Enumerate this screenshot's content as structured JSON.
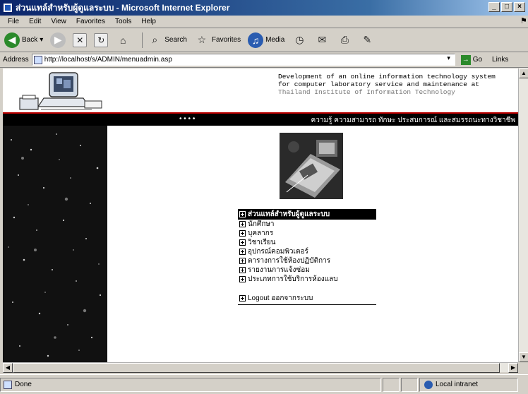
{
  "window": {
    "title": "ส่วนแทล์สำหรับผู้ดูแลระบบ - Microsoft Internet Explorer",
    "minimize": "_",
    "maximize": "□",
    "close": "×"
  },
  "menubar": [
    "File",
    "Edit",
    "View",
    "Favorites",
    "Tools",
    "Help"
  ],
  "toolbar": {
    "back": "Back",
    "search": "Search",
    "favorites": "Favorites",
    "media": "Media"
  },
  "address": {
    "label": "Address",
    "url": "http://localhost/s/ADMIN/menuadmin.asp",
    "go": "Go",
    "links": "Links"
  },
  "banner": {
    "line1": "Development of an online information technology system",
    "line2": "for computer laboratory service and maintenance at",
    "line3": "Thailand Institute of Information Technology",
    "bar_dots": "• • • •",
    "bar_text": "ความรู้ ความสามารถ ทักษะ ประสบการณ์ และสมรรถนะทางวิชาชีพ"
  },
  "admin_menu": {
    "header": "ส่วนแทล์สำหรับผู้ดูแลระบบ",
    "items": [
      "นักศึกษา",
      "บุคลากร",
      "วิชาเรียน",
      "อุปกรณ์คอมพิวเตอร์",
      "ตารางการใช้ห้องปฏิบัติการ",
      "รายงานการแจ้งซ่อม",
      "ประเภทการใช้บริการห้องแลบ"
    ],
    "logout": "Logout ออกจากระบบ"
  },
  "status": {
    "text": "Done",
    "zone": "Local intranet"
  },
  "colors": {
    "titlebar_start": "#0a246a",
    "banner_rule": "#b00000",
    "menu_header_bg": "#000000"
  }
}
